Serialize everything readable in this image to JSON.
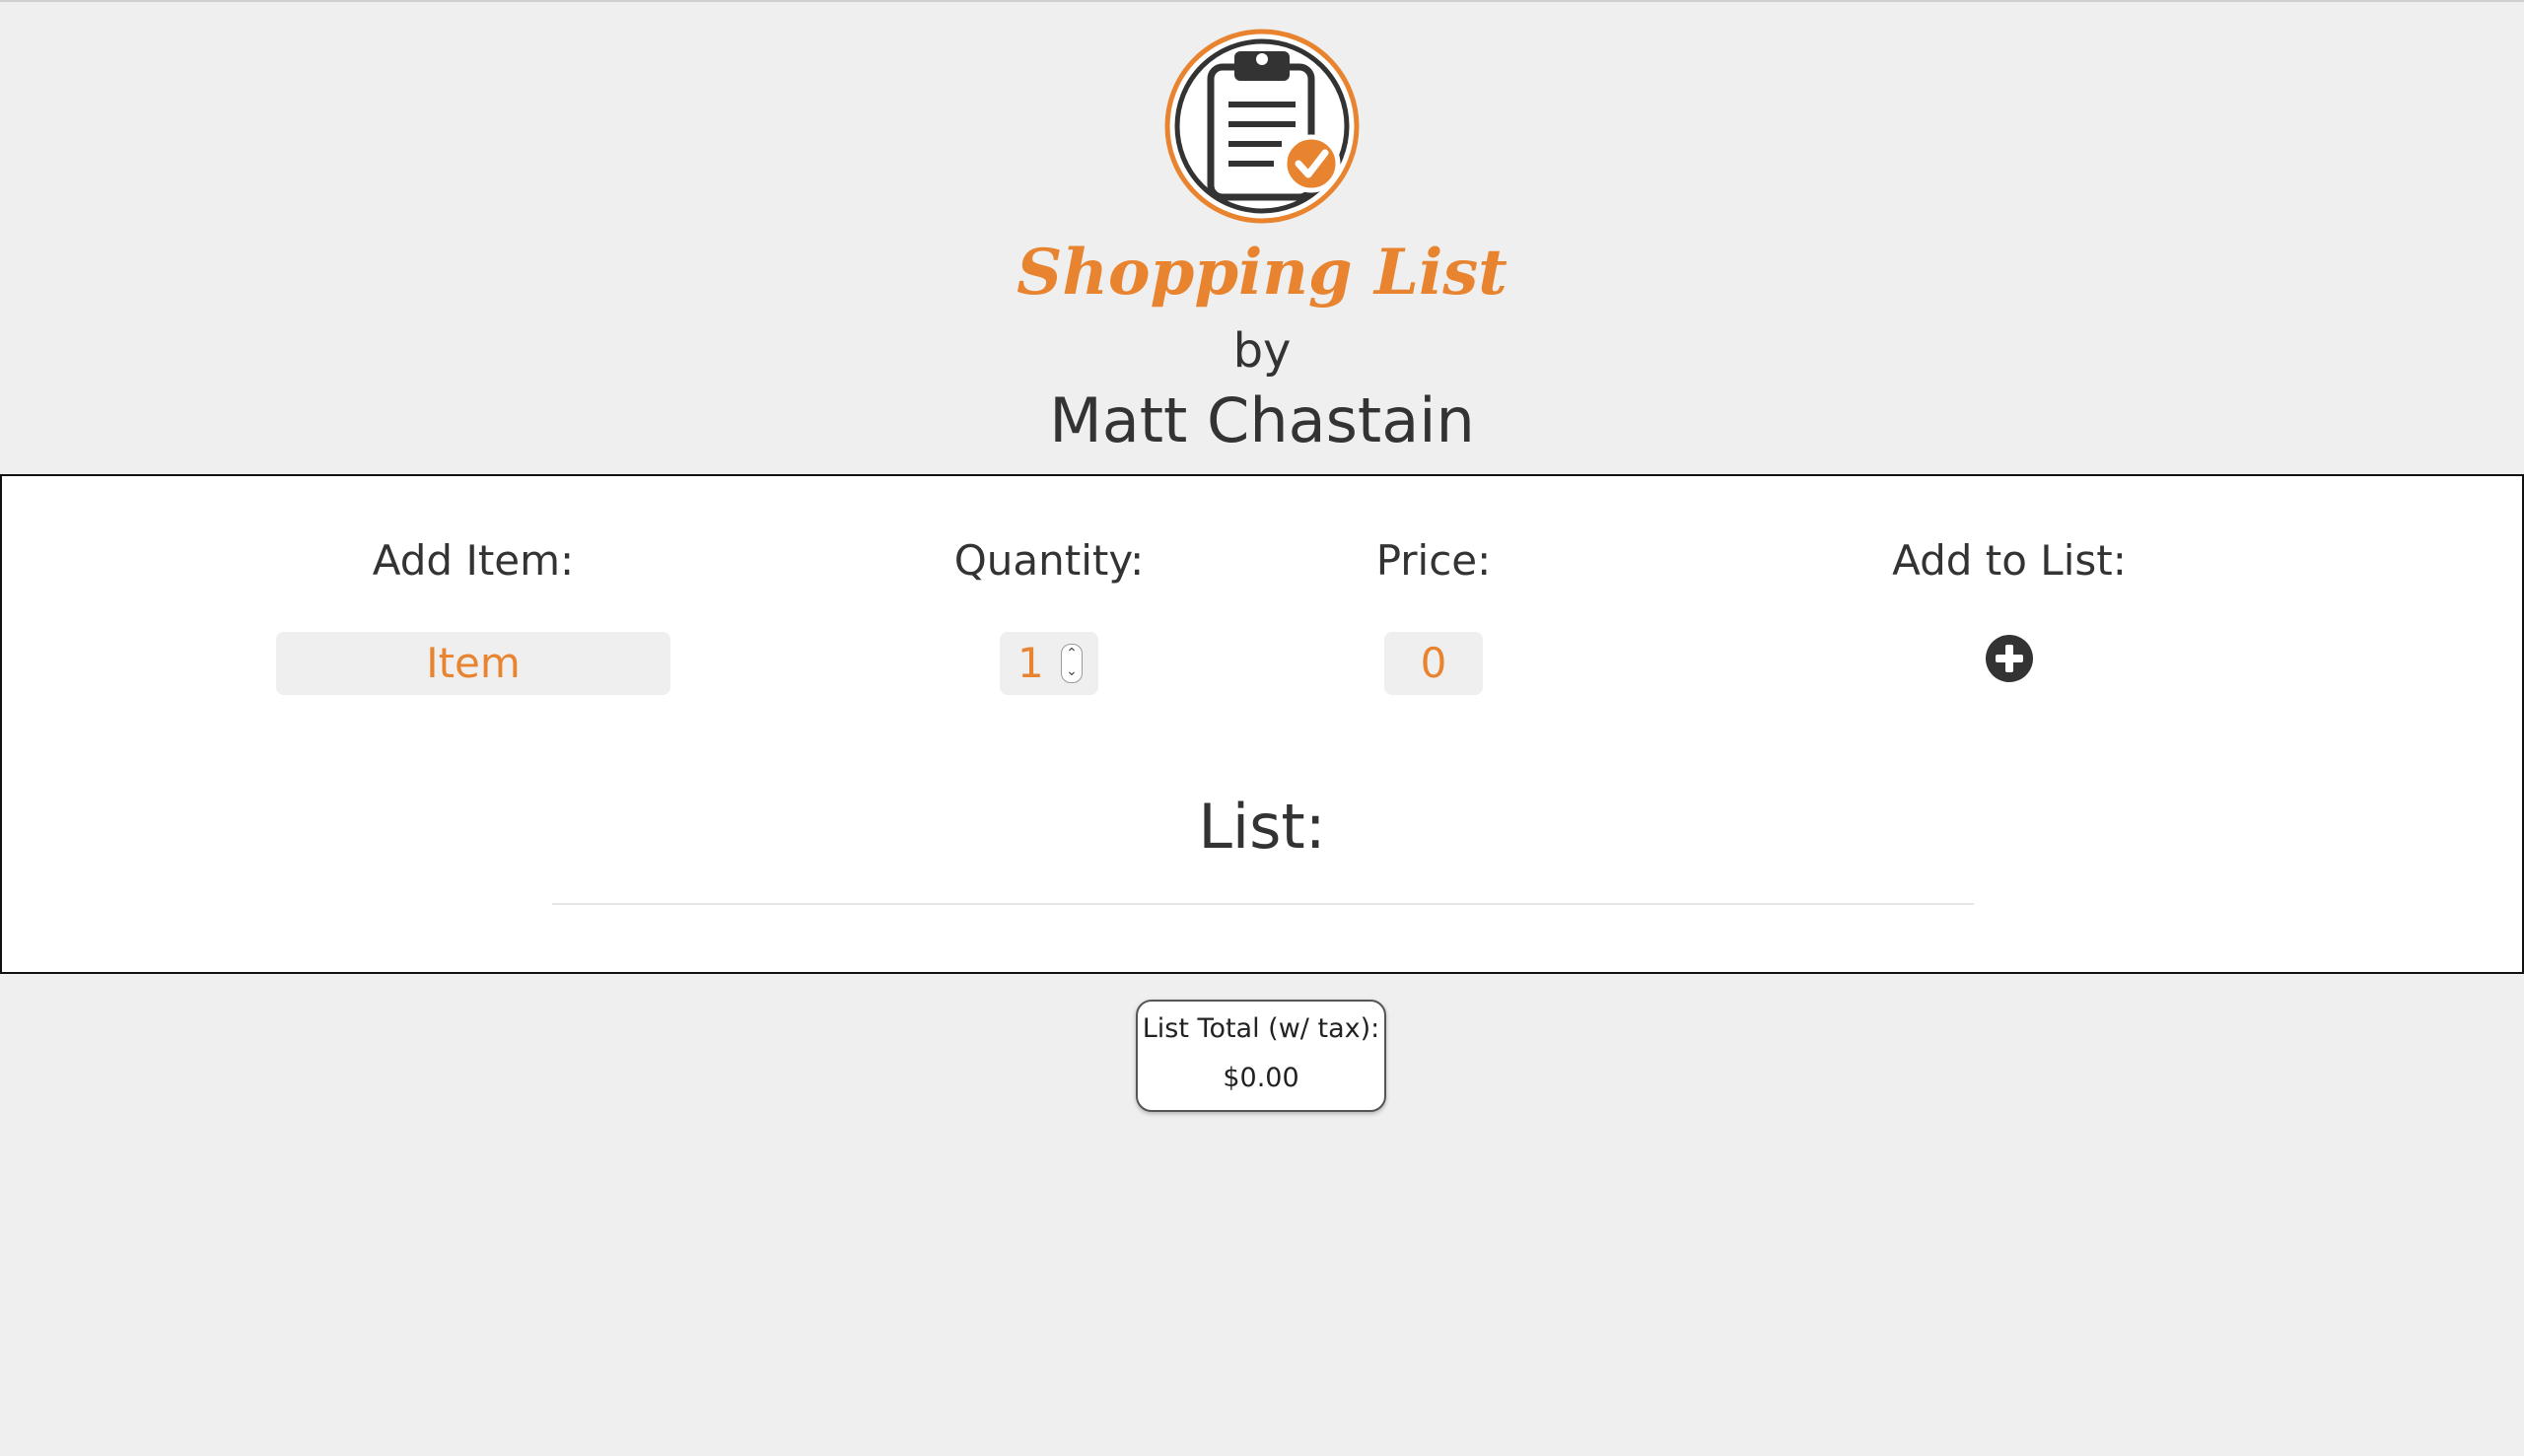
{
  "app": {
    "title": "Shopping List",
    "byline": "by",
    "author": "Matt Chastain",
    "logo_icon": "clipboard-check-icon"
  },
  "form": {
    "item_label": "Add Item:",
    "item_placeholder": "Item",
    "quantity_label": "Quantity:",
    "quantity_value": "1",
    "price_label": "Price:",
    "price_value": "0",
    "add_label": "Add to List:",
    "add_icon": "plus-circle-icon"
  },
  "list": {
    "heading": "List:",
    "items": []
  },
  "total": {
    "label": "List Total (w/ tax):",
    "value": "$0.00"
  },
  "colors": {
    "accent": "#e8842f",
    "background": "#efefef",
    "text": "#333333",
    "icon_dark": "#333333"
  }
}
